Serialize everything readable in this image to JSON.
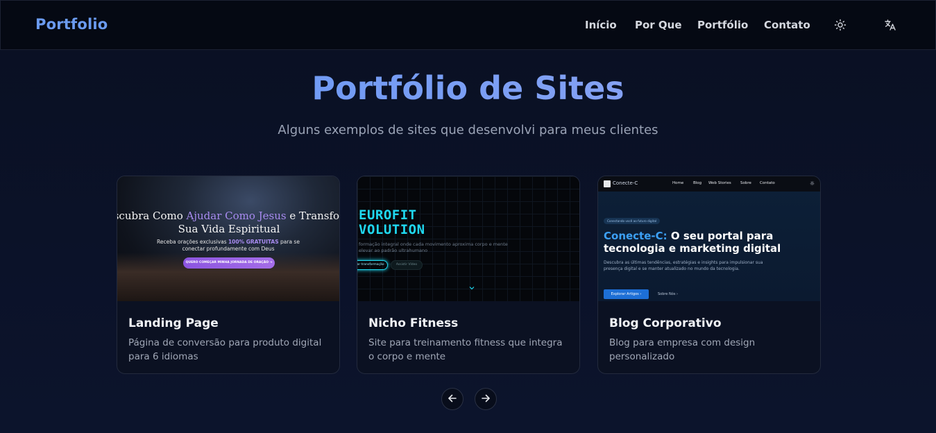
{
  "brand": "Portfolio",
  "nav": {
    "items": [
      {
        "label": "Início"
      },
      {
        "label": "Por Que"
      },
      {
        "label": "Portfólio"
      },
      {
        "label": "Contato"
      }
    ],
    "theme_icon": "sun-icon",
    "language_icon": "translate-icon"
  },
  "section": {
    "title": "Portfólio de Sites",
    "subtitle": "Alguns exemplos de sites que desenvolvi para meus clientes"
  },
  "projects": [
    {
      "title": "Landing Page",
      "description": "Página de conversão para produto digital para 6 idiomas",
      "preview": {
        "headline_pre": "scubra Como ",
        "headline_hl": "Ajudar Como Jesus",
        "headline_post": " e Transfor",
        "headline_line2": "Sua Vida Espiritual",
        "sub_pre": "Receba orações exclusivas ",
        "sub_hl": "100% GRATUITAS",
        "sub_post": " para se conectar profundamente com Deus",
        "cta": "QUERO COMEÇAR MINHA JORNADA DE ORAÇÃO →"
      }
    },
    {
      "title": "Nicho Fitness",
      "description": "Site para treinamento fitness que integra o corpo e mente",
      "preview": {
        "line1": "EUROFIT",
        "line2": "VOLUTION",
        "sub": "formação integral onde cada movimento aproxima corpo e mente elevar ao padrão ultrahumano",
        "btn1": "niar transformação",
        "btn2": "Assistir Vídeo"
      }
    },
    {
      "title": "Blog Corporativo",
      "description": "Blog para empresa com design personalizado",
      "preview": {
        "logo": "Conecte-C",
        "nav": [
          "Home",
          "Blog",
          "Web Stories",
          "Sobre",
          "Contato"
        ],
        "pill": "Conectando você ao futuro digital",
        "h1_accent": "Conecte-C:",
        "h1_rest": " O seu portal para tecnologia e marketing digital",
        "p": "Descubra as últimas tendências, estratégias e insights para impulsionar sua presença digital e se manter atualizado no mundo da tecnologia.",
        "btn1": "Explorar Artigos  ›",
        "btn2": "Sobre Nós  ›"
      }
    }
  ],
  "carousel": {
    "prev_icon": "arrow-left-icon",
    "next_icon": "arrow-right-icon"
  }
}
